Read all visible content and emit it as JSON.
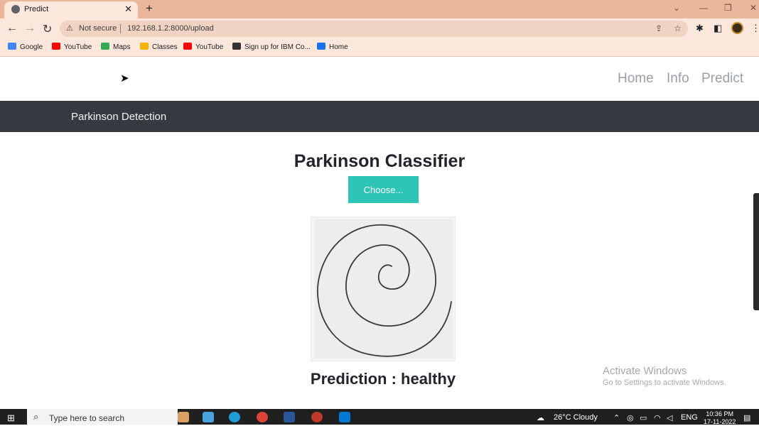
{
  "browser": {
    "tab_title": "Predict",
    "tab_close": "✕",
    "new_tab": "+",
    "window_controls": [
      "⌄",
      "—",
      "❐",
      "✕"
    ],
    "nav": {
      "back": "←",
      "forward": "→",
      "reload": "↻"
    },
    "security_icon": "⚠",
    "security_label": "Not secure",
    "url": "192.168.1.2:8000/upload",
    "bookmarks": [
      {
        "label": "Google",
        "icon_color": "#4285f4"
      },
      {
        "label": "YouTube",
        "icon_color": "#ff0000"
      },
      {
        "label": "Maps",
        "icon_color": "#34a853"
      },
      {
        "label": "Classes",
        "icon_color": "#f4b400"
      },
      {
        "label": "YouTube",
        "icon_color": "#ff0000"
      },
      {
        "label": "Sign up for IBM Co...",
        "icon_color": "#333333"
      },
      {
        "label": "Home",
        "icon_color": "#1a73e8"
      }
    ]
  },
  "site": {
    "nav": [
      "Home",
      "Info",
      "Predict"
    ],
    "brand": "Parkinson Detection",
    "heading": "Parkinson Classifier",
    "choose_button": "Choose...",
    "prediction_label": "Prediction : healthy"
  },
  "watermark": {
    "line1": "Activate Windows",
    "line2": "Go to Settings to activate Windows."
  },
  "taskbar": {
    "search_placeholder": "Type here to search",
    "weather": "26°C  Cloudy",
    "language": "ENG",
    "time": "10:36 PM",
    "date": "17-11-2022"
  },
  "colors": {
    "tab_strip": "#eab79d",
    "brand_bar": "#343a40",
    "choose_button": "#2ec4b6"
  }
}
